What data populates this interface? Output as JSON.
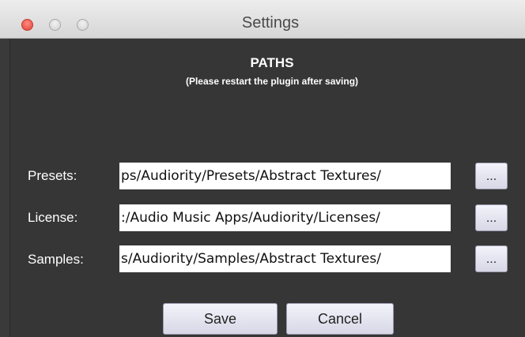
{
  "window": {
    "title": "Settings"
  },
  "header": {
    "title": "PATHS",
    "subtitle": "(Please restart the plugin after saving)"
  },
  "paths": [
    {
      "label": "Presets:",
      "value": "ps/Audiority/Presets/Abstract Textures/",
      "browse_label": "..."
    },
    {
      "label": "License:",
      "value": ":/Audio Music Apps/Audiority/Licenses/",
      "browse_label": "..."
    },
    {
      "label": "Samples:",
      "value": "s/Audiority/Samples/Abstract Textures/",
      "browse_label": "..."
    }
  ],
  "actions": {
    "save_label": "Save",
    "cancel_label": "Cancel"
  },
  "icons": {
    "close": "close-traffic-light-icon",
    "minimize": "minimize-traffic-light-icon",
    "maximize": "maximize-traffic-light-icon"
  },
  "colors": {
    "close_button": "#e0443a",
    "panel_background": "#363636",
    "button_face": "#e3e3ef"
  }
}
